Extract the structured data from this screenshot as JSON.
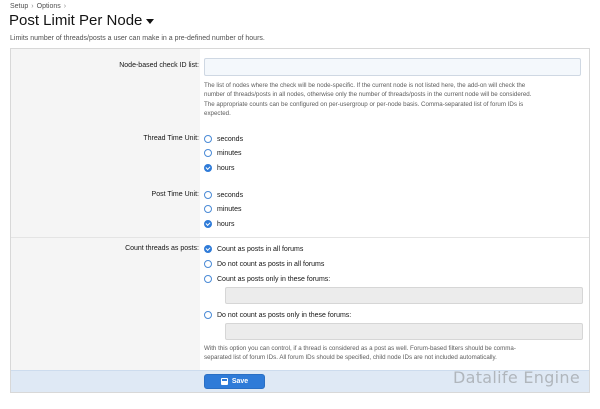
{
  "breadcrumb": [
    "Setup",
    "Options"
  ],
  "page_title": "Post Limit Per Node",
  "description": "Limits number of threads/posts a user can make in a pre-defined number of hours.",
  "node_check": {
    "label": "Node-based check ID list:",
    "value": "",
    "explain_lines": [
      "The list of nodes where the check will be node-specific. If the current node is not listed here, the add-on will check the",
      "number of threads/posts in all nodes, otherwise only the number of threads/posts in the current node will be considered.",
      "The appropriate counts can be configured on per-usergroup or per-node basis. Comma-separated list of forum IDs is",
      "expected."
    ]
  },
  "thread_time_unit": {
    "label": "Thread Time Unit:",
    "options": [
      {
        "label": "seconds",
        "checked": false
      },
      {
        "label": "minutes",
        "checked": false
      },
      {
        "label": "hours",
        "checked": true
      }
    ]
  },
  "post_time_unit": {
    "label": "Post Time Unit:",
    "options": [
      {
        "label": "seconds",
        "checked": false
      },
      {
        "label": "minutes",
        "checked": false
      },
      {
        "label": "hours",
        "checked": true
      }
    ]
  },
  "count_threads": {
    "label": "Count threads as posts:",
    "options": [
      {
        "label": "Count as posts in all forums",
        "checked": true
      },
      {
        "label": "Do not count as posts in all forums",
        "checked": false
      },
      {
        "label": "Count as posts only in these forums:",
        "checked": false
      },
      {
        "label": "Do not count as posts only in these forums:",
        "checked": false
      }
    ],
    "explain_lines": [
      "With this option you can control, if a thread is considered as a post as well. Forum-based filters should be comma-",
      "separated list of forum IDs. All forum IDs should be specified, child node IDs are not included automatically."
    ]
  },
  "save_label": "Save",
  "watermark": "Datalife Engine"
}
